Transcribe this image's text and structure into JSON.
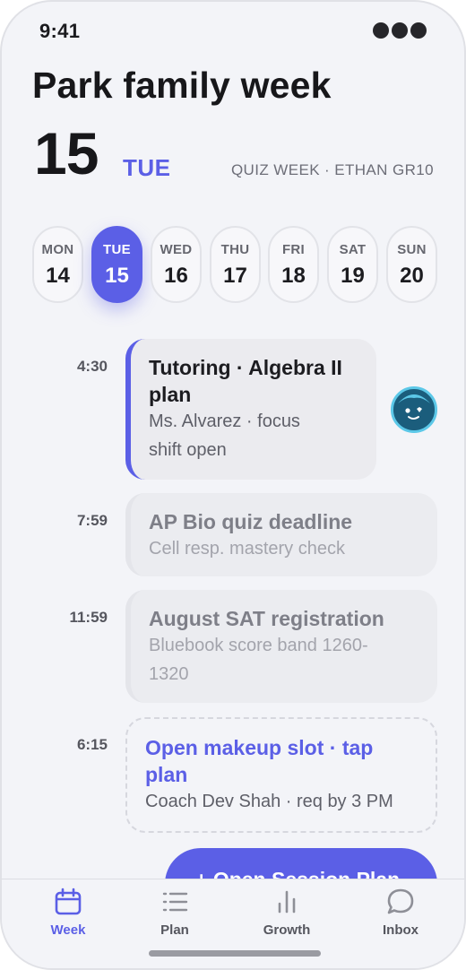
{
  "status": {
    "time": "9:41"
  },
  "header": {
    "title": "Park family week",
    "date_number": "15",
    "day": "TUE",
    "tag": "QUIZ WEEK · ETHAN GR10"
  },
  "days": [
    {
      "name": "MON",
      "num": "14",
      "selected": false
    },
    {
      "name": "TUE",
      "num": "15",
      "selected": true
    },
    {
      "name": "WED",
      "num": "16",
      "selected": false
    },
    {
      "name": "THU",
      "num": "17",
      "selected": false
    },
    {
      "name": "FRI",
      "num": "18",
      "selected": false
    },
    {
      "name": "SAT",
      "num": "19",
      "selected": false
    },
    {
      "name": "SUN",
      "num": "20",
      "selected": false
    }
  ],
  "events": [
    {
      "time": "4:30",
      "title_line1": "Tutoring · Algebra II",
      "title_line2": "plan",
      "sub_line1": "Ms. Alvarez · focus",
      "sub_line2": "shift open"
    },
    {
      "time": "7:59",
      "title_line1": "AP Bio quiz deadline",
      "sub_line1": "Cell resp. mastery check"
    },
    {
      "time": "11:59",
      "title_line1": "August SAT registration",
      "sub_line1": "Bluebook score band 1260-",
      "sub_line2": "1320"
    },
    {
      "time": "6:15",
      "title_line1": "Open makeup slot · tap",
      "title_line2": "plan",
      "sub_line1": "Coach Dev Shah · req by 3 PM"
    }
  ],
  "cta": {
    "label": "+ Open Session Plan"
  },
  "tabs": [
    {
      "label": "Week",
      "icon": "calendar-icon",
      "active": true
    },
    {
      "label": "Plan",
      "icon": "list-icon",
      "active": false
    },
    {
      "label": "Growth",
      "icon": "bar-chart-icon",
      "active": false
    },
    {
      "label": "Inbox",
      "icon": "chat-bubble-icon",
      "active": false
    }
  ],
  "colors": {
    "accent": "#5b5fe6",
    "background": "#f3f4f8",
    "card": "#ebecf0",
    "avatar": "#1b5d7c"
  }
}
